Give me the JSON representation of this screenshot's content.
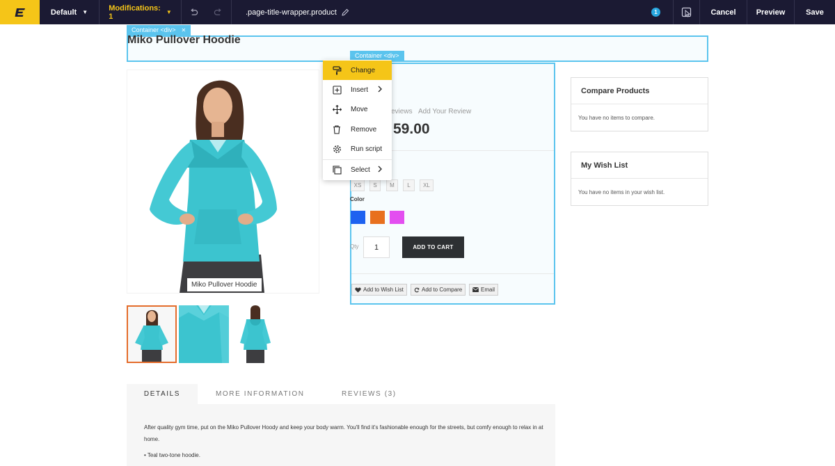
{
  "toolbar": {
    "logo_icon": "brand-e-icon",
    "default_label": "Default",
    "modifications_label": "Modifications: 1",
    "selector_text": ".page-title-wrapper.product",
    "badge_count": "1",
    "cancel_label": "Cancel",
    "preview_label": "Preview",
    "save_label": "Save"
  },
  "labels": {
    "title_container": "Container <div>",
    "info_container": "Container <div>"
  },
  "product": {
    "title": "Miko Pullover Hoodie",
    "gallery_caption": "Miko Pullover Hoodie",
    "reviews_partial": "eviews",
    "add_review": "Add Your Review",
    "price_partial": "59.00",
    "sizes": [
      "XS",
      "S",
      "M",
      "L",
      "XL"
    ],
    "color_label": "Color",
    "swatches": [
      "#1e62f0",
      "#e8701e",
      "#e34ef0"
    ],
    "qty_label": "Qty",
    "qty_value": "1",
    "add_to_cart": "ADD TO CART",
    "wishlist_btn": "Add to Wish List",
    "compare_btn": "Add to Compare",
    "email_btn": "Email"
  },
  "context_menu": {
    "items": [
      {
        "label": "Change",
        "icon": "paint-roller-icon"
      },
      {
        "label": "Insert",
        "icon": "plus-square-icon"
      },
      {
        "label": "Move",
        "icon": "move-arrows-icon"
      },
      {
        "label": "Remove",
        "icon": "trash-icon"
      },
      {
        "label": "Run script",
        "icon": "gear-icon"
      },
      {
        "label": "Select",
        "icon": "select-layers-icon"
      }
    ]
  },
  "sidebar": {
    "compare_title": "Compare Products",
    "compare_body": "You have no items to compare.",
    "wishlist_title": "My Wish List",
    "wishlist_body": "You have no items in your wish list."
  },
  "tabs": {
    "details": "DETAILS",
    "more_info": "MORE INFORMATION",
    "reviews": "REVIEWS (3)"
  },
  "details": {
    "description": "After quality gym time, put on the Miko Pullover Hoody and keep your body warm. You'll find it's fashionable enough for the streets, but comfy enough to relax in at home.",
    "bullet1": "• Teal two-tone hoodie."
  },
  "colors": {
    "topbar": "#1b1a33",
    "accent": "#f5c518",
    "highlight": "#5bc4ee",
    "selected_thumb": "#e46c2a"
  }
}
